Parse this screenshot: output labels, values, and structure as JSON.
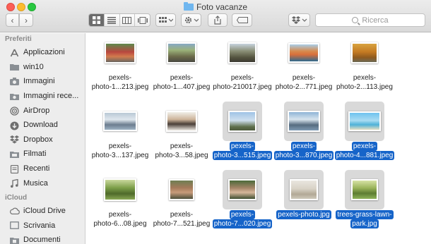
{
  "window": {
    "title": "Foto vacanze",
    "search_placeholder": "Ricerca"
  },
  "toolbar": {
    "back_glyph": "‹",
    "forward_glyph": "›",
    "view_modes": [
      "icon-view",
      "list-view",
      "column-view",
      "gallery-view"
    ],
    "active_view": "icon-view"
  },
  "sidebar": {
    "favorites_header": "Preferiti",
    "favorites": [
      {
        "label": "Applicazioni",
        "icon": "applications-icon"
      },
      {
        "label": "win10",
        "icon": "folder-icon"
      },
      {
        "label": "Immagini",
        "icon": "camera-icon"
      },
      {
        "label": "Immagini rece...",
        "icon": "recent-images-icon"
      },
      {
        "label": "AirDrop",
        "icon": "airdrop-icon"
      },
      {
        "label": "Download",
        "icon": "download-icon"
      },
      {
        "label": "Dropbox",
        "icon": "dropbox-icon"
      },
      {
        "label": "Filmati",
        "icon": "film-icon"
      },
      {
        "label": "Recenti",
        "icon": "recents-icon"
      },
      {
        "label": "Musica",
        "icon": "music-icon"
      }
    ],
    "icloud_header": "iCloud",
    "icloud": [
      {
        "label": "iCloud Drive",
        "icon": "cloud-icon"
      },
      {
        "label": "Scrivania",
        "icon": "desktop-icon"
      },
      {
        "label": "Documenti",
        "icon": "documents-icon"
      }
    ]
  },
  "files": [
    {
      "line1": "pexels-",
      "line2": "photo-1...213.jpeg",
      "selected": false
    },
    {
      "line1": "pexels-",
      "line2": "photo-1...407.jpeg",
      "selected": false
    },
    {
      "line1": "pexels-",
      "line2": "photo-210017.jpeg",
      "selected": false
    },
    {
      "line1": "pexels-",
      "line2": "photo-2...771.jpeg",
      "selected": false
    },
    {
      "line1": "pexels-",
      "line2": "photo-2...113.jpeg",
      "selected": false
    },
    {
      "line1": "pexels-",
      "line2": "photo-3...137.jpeg",
      "selected": false
    },
    {
      "line1": "pexels-",
      "line2": "photo-3...58.jpeg",
      "selected": false
    },
    {
      "line1": "pexels-",
      "line2": "photo-3...515.jpeg",
      "selected": true
    },
    {
      "line1": "pexels-",
      "line2": "photo-3...870.jpeg",
      "selected": true
    },
    {
      "line1": "pexels-",
      "line2": "photo-4...881.jpeg",
      "selected": true
    },
    {
      "line1": "pexels-",
      "line2": "photo-6...08.jpeg",
      "selected": false
    },
    {
      "line1": "pexels-",
      "line2": "photo-7...521.jpeg",
      "selected": false
    },
    {
      "line1": "pexels-",
      "line2": "photo-7...020.jpeg",
      "selected": true
    },
    {
      "line1": "pexels-photo.jpg",
      "line2": "",
      "selected": true
    },
    {
      "line1": "trees-grass-lawn-",
      "line2": "park.jpg",
      "selected": true
    }
  ],
  "colors": {
    "selection": "#1664c9",
    "sidebar_bg": "#ededed"
  }
}
